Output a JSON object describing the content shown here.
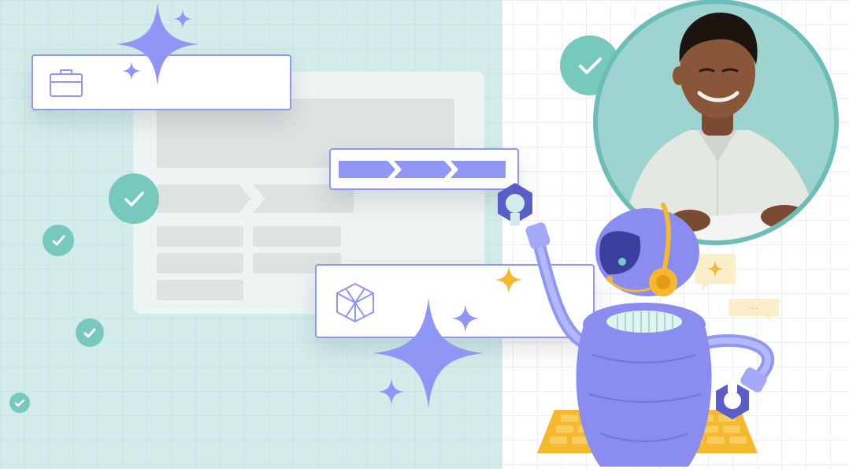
{
  "colors": {
    "teal_panel": "#d3ecea",
    "check_teal": "#76c9bc",
    "accent_purple": "#8f96f4",
    "robot_purple": "#8a8cf0",
    "robot_dark": "#5b5dc8",
    "gold": "#f5b82e"
  },
  "cards": [
    {
      "id": "briefcase-card",
      "icon": "briefcase-icon"
    },
    {
      "id": "progress-card",
      "icon": "chevron-steps"
    },
    {
      "id": "cube-card",
      "icon": "cube-icon"
    }
  ],
  "icons": [
    "sparkle-icon",
    "check-icon",
    "briefcase-icon",
    "cube-icon",
    "chat-bubble-icon",
    "headset-icon"
  ],
  "illustrations": [
    "robot",
    "person-with-tablet"
  ],
  "chat_bubble_text": "..."
}
